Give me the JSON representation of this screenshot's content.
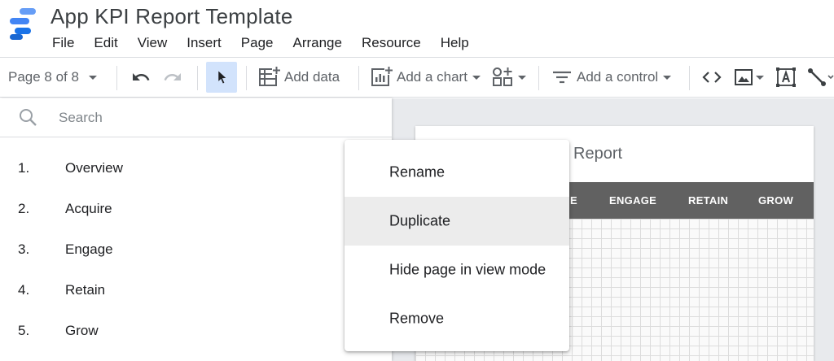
{
  "app": {
    "title": "App KPI Report Template"
  },
  "menu": [
    "File",
    "Edit",
    "View",
    "Insert",
    "Page",
    "Arrange",
    "Resource",
    "Help"
  ],
  "toolbar": {
    "page_indicator": "Page 8 of 8",
    "add_data": "Add data",
    "add_chart": "Add a chart",
    "add_control": "Add a control"
  },
  "search": {
    "placeholder": "Search"
  },
  "pages": [
    {
      "num": "1.",
      "name": "Overview"
    },
    {
      "num": "2.",
      "name": "Acquire"
    },
    {
      "num": "3.",
      "name": "Engage"
    },
    {
      "num": "4.",
      "name": "Retain"
    },
    {
      "num": "5.",
      "name": "Grow"
    }
  ],
  "context_menu": {
    "items": [
      "Rename",
      "Duplicate",
      "Hide page in view mode",
      "Remove"
    ],
    "highlighted": "Duplicate"
  },
  "report": {
    "title_fragment": "Report",
    "nav": [
      "E",
      "ENGAGE",
      "RETAIN",
      "GROW"
    ],
    "nav_color": "#616161"
  },
  "colors": {
    "accent": "#4285f4",
    "selected_tool_bg": "#d2e3fc"
  },
  "icons": [
    "logo-icon",
    "undo-icon",
    "redo-icon",
    "select-icon",
    "add-data-icon",
    "add-chart-icon",
    "community-viz-icon",
    "add-control-icon",
    "embed-icon",
    "image-icon",
    "text-icon",
    "line-icon",
    "search-icon"
  ]
}
